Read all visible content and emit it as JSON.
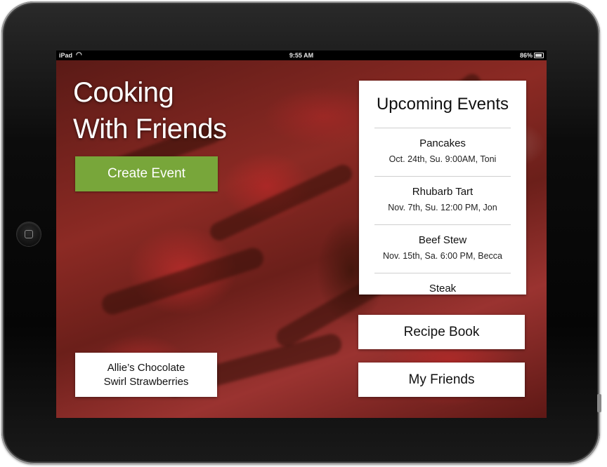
{
  "status_bar": {
    "carrier": "iPad",
    "time": "9:55 AM",
    "battery": "86%",
    "battery_level": 0.86
  },
  "app": {
    "title_line1": "Cooking",
    "title_line2": "With Friends"
  },
  "create_event": {
    "label": "Create Event"
  },
  "featured_recipe": {
    "line1": "Allie’s Chocolate",
    "line2": "Swirl Strawberries"
  },
  "events": {
    "title": "Upcoming Events",
    "items": [
      {
        "name": "Pancakes",
        "details": "Oct. 24th, Su. 9:00AM, Toni"
      },
      {
        "name": "Rhubarb Tart",
        "details": "Nov. 7th, Su. 12:00 PM, Jon"
      },
      {
        "name": "Beef Stew",
        "details": "Nov. 15th, Sa. 6:00 PM, Becca"
      },
      {
        "name": "Steak",
        "details": ""
      }
    ]
  },
  "nav": {
    "recipe_book": "Recipe Book",
    "my_friends": "My Friends"
  },
  "colors": {
    "accent_green": "#78a63a",
    "panel_white": "#ffffff",
    "bezel": "#0a0a0a"
  }
}
